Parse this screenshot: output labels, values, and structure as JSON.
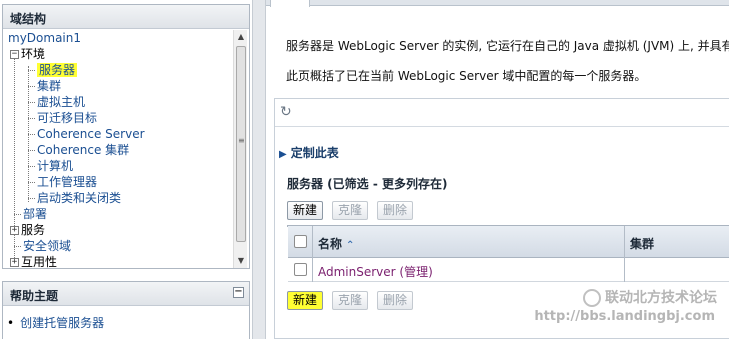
{
  "domain_structure": {
    "title": "域结构",
    "root": "myDomain1",
    "env_node": "环境",
    "env_children": [
      "服务器",
      "集群",
      "虚拟主机",
      "可迁移目标",
      "Coherence Server",
      "Coherence 集群",
      "计算机",
      "工作管理器",
      "启动类和关闭类"
    ],
    "other_nodes": [
      "部署",
      "服务",
      "安全领域",
      "互用性"
    ],
    "selected": "服务器"
  },
  "help_topics": {
    "title": "帮助主题",
    "items": [
      "创建托管服务器"
    ]
  },
  "content": {
    "desc_line1": "服务器是 WebLogic Server 的实例, 它运行在自己的 Java 虚拟机 (JVM) 上, 并具有自",
    "desc_line2": "此页概括了已在当前 WebLogic Server 域中配置的每一个服务器。",
    "customize_label": "定制此表",
    "table_title": "服务器 (已筛选 - 更多列存在)",
    "buttons": {
      "new": "新建",
      "clone": "克隆",
      "delete": "删除"
    },
    "columns": {
      "name": "名称",
      "cluster": "集群"
    },
    "rows": [
      {
        "name": "AdminServer (管理)",
        "cluster": ""
      }
    ]
  },
  "watermark": {
    "line1": "联动北方技术论坛",
    "line2": "http://bbs.landingbj.com"
  },
  "colors": {
    "highlight": "#ffff33",
    "link": "#1b4f92",
    "visited_link": "#7a1f6e"
  }
}
